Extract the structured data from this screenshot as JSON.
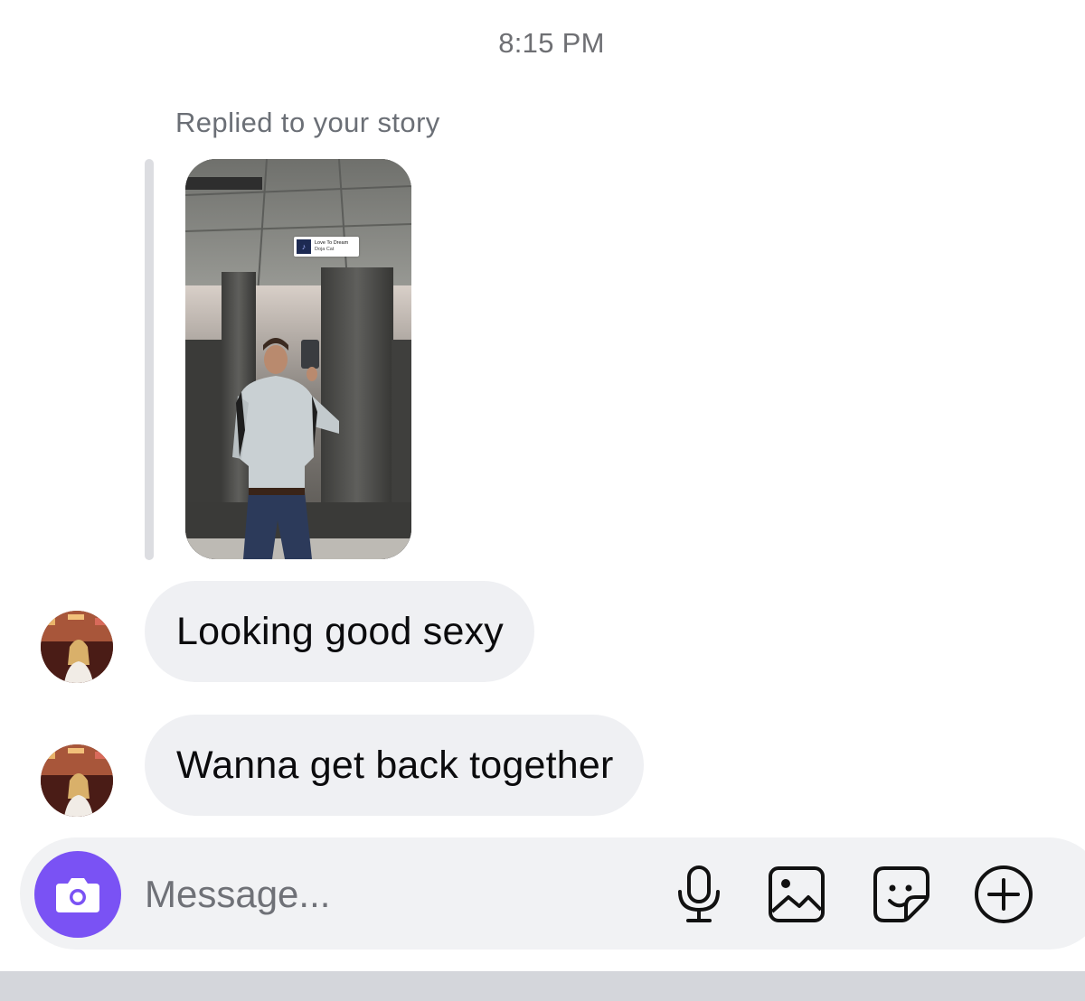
{
  "thread": {
    "timestamp": "8:15 PM",
    "reply_label": "Replied to your story",
    "story": {
      "music_sticker": {
        "title": "Love To Dream",
        "artist": "Doja Cat"
      }
    },
    "messages": [
      {
        "text": "Looking good sexy"
      },
      {
        "text": "Wanna get back together"
      }
    ]
  },
  "composer": {
    "placeholder": "Message...",
    "icons": [
      "camera-icon",
      "microphone-icon",
      "image-icon",
      "sticker-icon",
      "plus-circle-icon"
    ]
  },
  "colors": {
    "accent": "#7a52f4",
    "bubble": "#eff0f3",
    "composer_bg": "#f1f2f4",
    "muted_text": "#6e6f73"
  }
}
